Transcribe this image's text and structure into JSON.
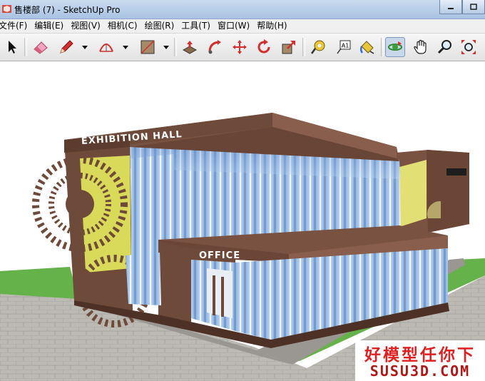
{
  "window": {
    "title": "售楼部 (7) - SketchUp Pro"
  },
  "menu": {
    "items": [
      {
        "label": "文件(F)"
      },
      {
        "label": "编辑(E)"
      },
      {
        "label": "视图(V)"
      },
      {
        "label": "相机(C)"
      },
      {
        "label": "绘图(R)"
      },
      {
        "label": "工具(T)"
      },
      {
        "label": "窗口(W)"
      },
      {
        "label": "帮助(H)"
      }
    ]
  },
  "toolbar": {
    "tools": [
      "select-icon",
      "eraser-icon",
      "pencil-icon",
      "arc-icon",
      "rectangle-icon",
      "push-pull-icon",
      "follow-me-icon",
      "move-icon",
      "rotate-icon",
      "scale-icon",
      "tape-measure-icon",
      "text-label-icon",
      "paint-bucket-icon",
      "orbit-icon",
      "pan-icon",
      "zoom-icon",
      "zoom-extents-icon"
    ],
    "text_tool_glyph": "A1",
    "active_tool": "orbit-icon"
  },
  "model": {
    "sign_exhibition": "EXHIBITION HALL",
    "sign_office": "OFFICE",
    "colors": {
      "facade": "#6e4a3a",
      "glass": "#9ec1e6",
      "accent": "#d9d95a",
      "sky": "#ffffff",
      "paving": "#b7b4ae",
      "grass": "#66b24a"
    }
  },
  "watermark": {
    "line1": "好模型任你下",
    "line2": "SUSU3D.COM"
  }
}
